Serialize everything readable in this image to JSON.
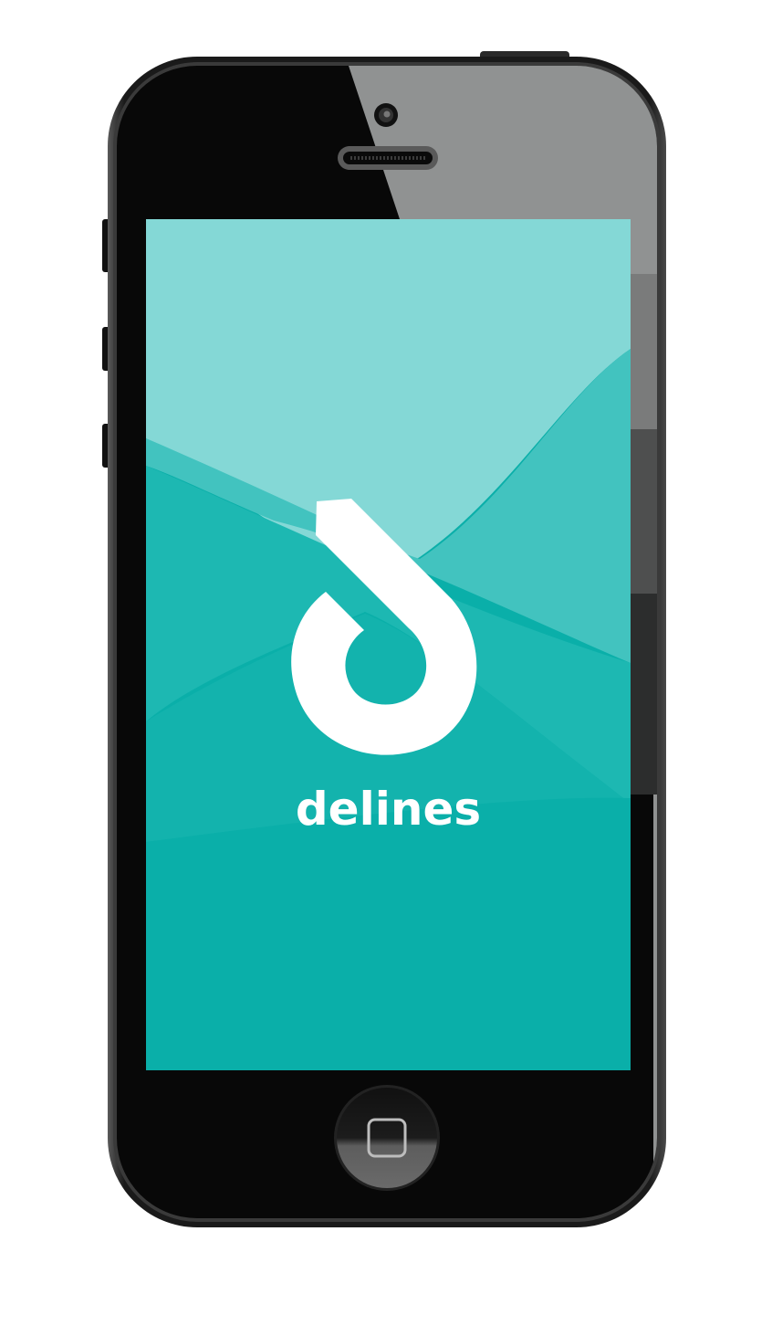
{
  "app": {
    "name": "delines",
    "logo_icon": "delines-logo-icon"
  },
  "colors": {
    "screen_top": "#84d8d6",
    "screen_mid": "#42c3bf",
    "screen_main": "#1db8b2",
    "screen_bottom": "#0aafa9",
    "phone_body": "#080808",
    "phone_reflection": "#909292",
    "logo": "#ffffff"
  },
  "device": {
    "type": "smartphone",
    "home_button_icon": "home-button-icon",
    "camera_icon": "front-camera-icon",
    "speaker_icon": "earpiece-speaker-icon"
  }
}
